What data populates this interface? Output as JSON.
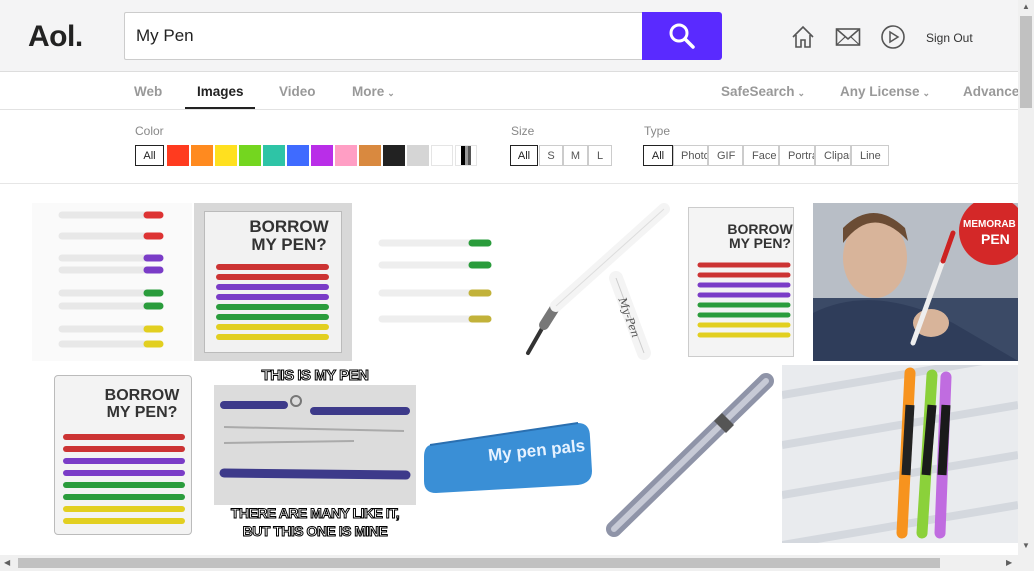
{
  "header": {
    "logo": "Aol.",
    "search_value": "My Pen",
    "sign_out": "Sign Out"
  },
  "nav": {
    "tabs": [
      {
        "label": "Web"
      },
      {
        "label": "Images",
        "active": true
      },
      {
        "label": "Video"
      },
      {
        "label": "More"
      }
    ],
    "right": [
      {
        "label": "SafeSearch"
      },
      {
        "label": "Any License"
      },
      {
        "label": "Advanced"
      }
    ]
  },
  "filters": {
    "color_label": "Color",
    "color_all": "All",
    "colors": [
      "#ff3b1f",
      "#ff8a1f",
      "#ffe01f",
      "#74d61f",
      "#2ec4a6",
      "#3f6bff",
      "#b92ee8",
      "#ff9ec4",
      "#d9893f",
      "#222222",
      "#d5d5d5",
      "#ffffff"
    ],
    "size_label": "Size",
    "sizes": [
      "All",
      "S",
      "M",
      "L"
    ],
    "type_label": "Type",
    "types": [
      "All",
      "Photo",
      "GIF",
      "Face",
      "Portrait",
      "Clipart",
      "Line"
    ]
  },
  "images": [
    {
      "alt": "pens"
    },
    {
      "alt": "borrow my pen package",
      "text_1": "BORROW",
      "text_2": "MY PEN?"
    },
    {
      "alt": "pens"
    },
    {
      "alt": "white pen",
      "text": "My-Pen"
    },
    {
      "alt": "borrow my pen package",
      "text_1": "BORROW",
      "text_2": "MY PEN?"
    },
    {
      "alt": "man holding pen",
      "text_1": "MEMORAB",
      "text_2": "PEN"
    },
    {
      "alt": "borrow my pen package",
      "text_1": "BORROW",
      "text_2": "MY PEN?"
    },
    {
      "alt": "meme",
      "top": "THIS IS MY PEN",
      "bottom_1": "THERE ARE MANY LIKE IT,",
      "bottom_2": "BUT THIS ONE IS MINE"
    },
    {
      "alt": "pencil case",
      "text": "My pen pals"
    },
    {
      "alt": "silver pen"
    },
    {
      "alt": "colorful pens"
    }
  ]
}
